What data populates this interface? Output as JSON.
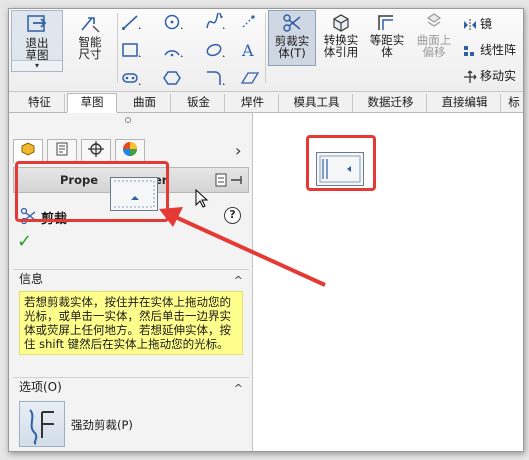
{
  "ribbon": {
    "exit_sketch": "退出草图",
    "smart_dimension": "智能尺寸",
    "trim_entities": "剪裁实体(T)",
    "convert_entities": "转换实体引用",
    "offset_entities": "等距实体",
    "offset_on_surface": "曲面上偏移",
    "mirror": "镜",
    "linear_pattern": "线性阵",
    "move": "移动实"
  },
  "tabs": [
    "特征",
    "草图",
    "曲面",
    "钣金",
    "焊件",
    "模具工具",
    "数据迁移",
    "直接编辑",
    "标"
  ],
  "active_tab": "草图",
  "panel": {
    "header_left": "Prope",
    "header_right": "er",
    "feature_title": "剪裁",
    "help_symbol": "?",
    "ok_symbol": "✓",
    "info_title": "信息",
    "info_text": "若想剪裁实体，按住并在实体上拖动您的光标，或单击一实体，然后单击一边界实体或荧屏上任何地方。若想延伸实体，按住 shift 键然后在实体上拖动您的光标。",
    "options_title": "选项(O)",
    "option_power_trim": "强劲剪裁(P)",
    "collapse_symbol": "^"
  },
  "colors": {
    "highlight": "#e53935",
    "info_bg": "#fefe8c",
    "accent_blue": "#2f5fa7"
  }
}
